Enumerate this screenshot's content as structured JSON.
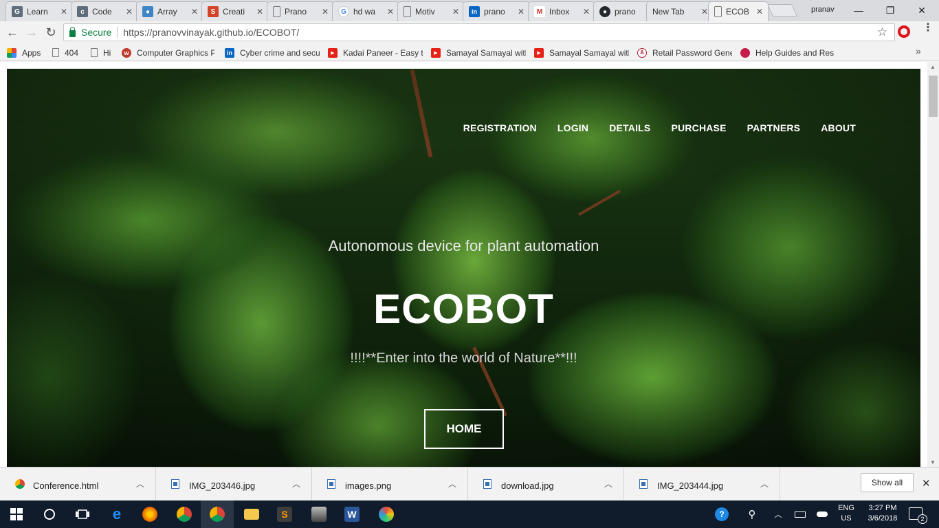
{
  "browser": {
    "tabs": [
      {
        "title": "Learn",
        "favicon": "G",
        "favicon_color": "#5f6d7a"
      },
      {
        "title": "Code",
        "favicon": "c",
        "favicon_color": "#5f6d7a"
      },
      {
        "title": "Array",
        "favicon": "●",
        "favicon_color": "#3d86c6"
      },
      {
        "title": "Creati",
        "favicon": "S",
        "favicon_color": "#d1452b"
      },
      {
        "title": "Prano",
        "favicon": "",
        "favicon_color": "transparent"
      },
      {
        "title": "hd wa",
        "favicon": "G",
        "favicon_color": "#4285f4"
      },
      {
        "title": "Motiv",
        "favicon": "",
        "favicon_color": "transparent"
      },
      {
        "title": "prano",
        "favicon": "in",
        "favicon_color": "#0a66c2"
      },
      {
        "title": "Inbox",
        "favicon": "M",
        "favicon_color": "#d93025"
      },
      {
        "title": "prano",
        "favicon": "●",
        "favicon_color": "#24292e"
      },
      {
        "title": "New Tab",
        "favicon": "",
        "favicon_color": "transparent"
      },
      {
        "title": "ECOB",
        "favicon": "",
        "favicon_color": "transparent"
      }
    ],
    "active_tab_index": 11,
    "profile_name": "pranav",
    "window_controls": {
      "minimize": "—",
      "maximize": "❐",
      "close": "✕"
    },
    "toolbar": {
      "back": "←",
      "forward": "→",
      "reload": "↻"
    },
    "omnibox": {
      "secure_label": "Secure",
      "url_host": "https://pranovvinayak.github.io/",
      "url_path": "ECOBOT/"
    },
    "bookmarks": [
      {
        "label": "Apps",
        "icon": "apps-grid-icon"
      },
      {
        "label": "404",
        "icon": "page-icon"
      },
      {
        "label": "Hi",
        "icon": "page-icon"
      },
      {
        "label": "Computer Graphics P",
        "icon": "w3-icon"
      },
      {
        "label": "Cyber crime and secu",
        "icon": "linkedin-icon"
      },
      {
        "label": "Kadai Paneer - Easy t",
        "icon": "youtube-icon"
      },
      {
        "label": "Samayal Samayal with",
        "icon": "youtube-icon"
      },
      {
        "label": "Samayal Samayal with",
        "icon": "youtube-icon"
      },
      {
        "label": "Retail Password Gene",
        "icon": "arista-icon"
      },
      {
        "label": "Help Guides and Res",
        "icon": "raspberry-icon"
      }
    ],
    "bookmarks_more": "»"
  },
  "page": {
    "nav": [
      "REGISTRATION",
      "LOGIN",
      "DETAILS",
      "PURCHASE",
      "PARTNERS",
      "ABOUT"
    ],
    "tagline": "Autonomous device for plant automation",
    "title": "ECOBOT",
    "subtitle": "!!!!**Enter into the world of Nature**!!!",
    "home_button": "HOME"
  },
  "downloads": {
    "items": [
      {
        "name": "Conference.html"
      },
      {
        "name": "IMG_203446.jpg"
      },
      {
        "name": "images.png"
      },
      {
        "name": "download.jpg"
      },
      {
        "name": "IMG_203444.jpg"
      }
    ],
    "show_all": "Show all",
    "close": "✕"
  },
  "taskbar": {
    "language_line1": "ENG",
    "language_line2": "US",
    "time": "3:27 PM",
    "date": "3/6/2018",
    "notification_count": "2"
  },
  "colors": {
    "secure_green": "#0b8043",
    "taskbar_bg": "#101b2b"
  }
}
